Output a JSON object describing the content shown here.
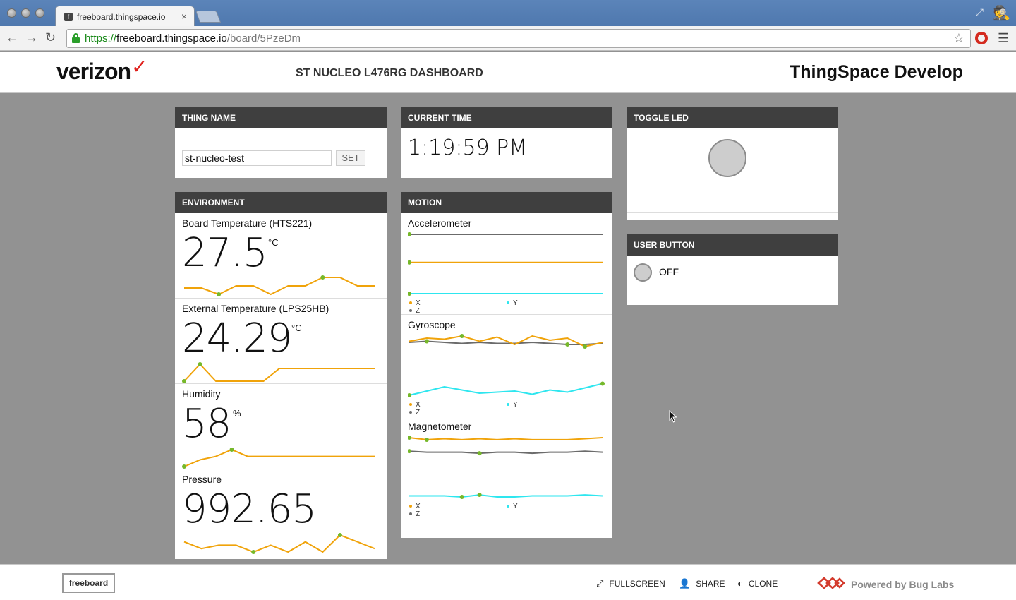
{
  "browser": {
    "tab_title": "freeboard.thingspace.io",
    "tab_close": "×",
    "url_scheme": "https://",
    "url_host": "freeboard.thingspace.io",
    "url_path": "/board/5PzeDm"
  },
  "header": {
    "logo_text": "verizon",
    "logo_check": "✓",
    "dashboard_title": "ST NUCLEO L476RG DASHBOARD",
    "brand": "ThingSpace Develop"
  },
  "thing_name": {
    "title": "THING NAME",
    "input_value": "st-nucleo-test",
    "set_label": "SET"
  },
  "current_time": {
    "title": "CURRENT TIME",
    "value": "1:19:59 PM"
  },
  "toggle_led": {
    "title": "TOGGLE LED"
  },
  "user_button": {
    "title": "USER BUTTON",
    "state": "OFF"
  },
  "environment": {
    "title": "ENVIRONMENT",
    "sensors": [
      {
        "label": "Board Temperature (HTS221)",
        "value": "27.5",
        "unit": "°C",
        "spark": [
          54,
          54,
          51,
          55,
          55,
          51,
          55,
          55,
          59,
          59,
          55,
          55
        ]
      },
      {
        "label": "External Temperature (LPS25HB)",
        "value": "24.29",
        "unit": "°C",
        "spark": [
          20,
          28,
          20,
          20,
          20,
          20,
          26,
          26,
          26,
          26,
          26,
          26,
          26
        ]
      },
      {
        "label": "Humidity",
        "value": "58",
        "unit": "%",
        "spark": [
          46,
          50,
          52,
          56,
          52,
          52,
          52,
          52,
          52,
          52,
          52,
          52,
          52
        ]
      },
      {
        "label": "Pressure",
        "value": "992.65",
        "unit": "",
        "spark": [
          16,
          12,
          14,
          14,
          10,
          14,
          10,
          16,
          10,
          20,
          16,
          12
        ]
      }
    ]
  },
  "motion": {
    "title": "MOTION",
    "legend": {
      "x": "X",
      "y": "Y",
      "z": "Z"
    },
    "colors": {
      "x": "#f0a30a",
      "y": "#2ee6ef",
      "z": "#6b6b6b",
      "marker": "#76b82a"
    },
    "charts": [
      {
        "label": "Accelerometer",
        "x": [
          0.1,
          0.1,
          0.1,
          0.1,
          0.1,
          0.1,
          0.1,
          0.1,
          0.1,
          0.1,
          0.1,
          0.1
        ],
        "y": [
          -0.9,
          -0.9,
          -0.9,
          -0.9,
          -0.9,
          -0.9,
          -0.9,
          -0.9,
          -0.9,
          -0.9,
          -0.9,
          -0.9
        ],
        "z": [
          1.0,
          1.0,
          1.0,
          1.0,
          1.0,
          1.0,
          1.0,
          1.0,
          1.0,
          1.0,
          1.0,
          1.0
        ]
      },
      {
        "label": "Gyroscope",
        "x": [
          0.1,
          0.4,
          0.3,
          0.6,
          0.1,
          0.5,
          -0.2,
          0.6,
          0.2,
          0.4,
          -0.4,
          0.0
        ],
        "y": [
          -5.0,
          -4.6,
          -4.2,
          -4.5,
          -4.8,
          -4.7,
          -4.6,
          -4.9,
          -4.5,
          -4.7,
          -4.3,
          -3.9
        ],
        "z": [
          0.0,
          0.1,
          0.0,
          -0.1,
          0.0,
          -0.1,
          -0.1,
          0.0,
          -0.1,
          -0.2,
          -0.2,
          -0.1
        ]
      },
      {
        "label": "Magnetometer",
        "x": [
          1.0,
          0.8,
          0.9,
          0.8,
          0.9,
          0.8,
          0.9,
          0.8,
          0.8,
          0.8,
          0.9,
          1.0
        ],
        "y": [
          -4.6,
          -4.6,
          -4.6,
          -4.7,
          -4.5,
          -4.7,
          -4.7,
          -4.6,
          -4.6,
          -4.6,
          -4.5,
          -4.6
        ],
        "z": [
          -0.3,
          -0.4,
          -0.4,
          -0.4,
          -0.5,
          -0.4,
          -0.4,
          -0.5,
          -0.4,
          -0.4,
          -0.3,
          -0.4
        ]
      }
    ]
  },
  "footer": {
    "freeboard": "freeboard",
    "fullscreen": "FULLSCREEN",
    "share": "SHARE",
    "clone": "CLONE",
    "powered": "Powered by Bug Labs"
  }
}
